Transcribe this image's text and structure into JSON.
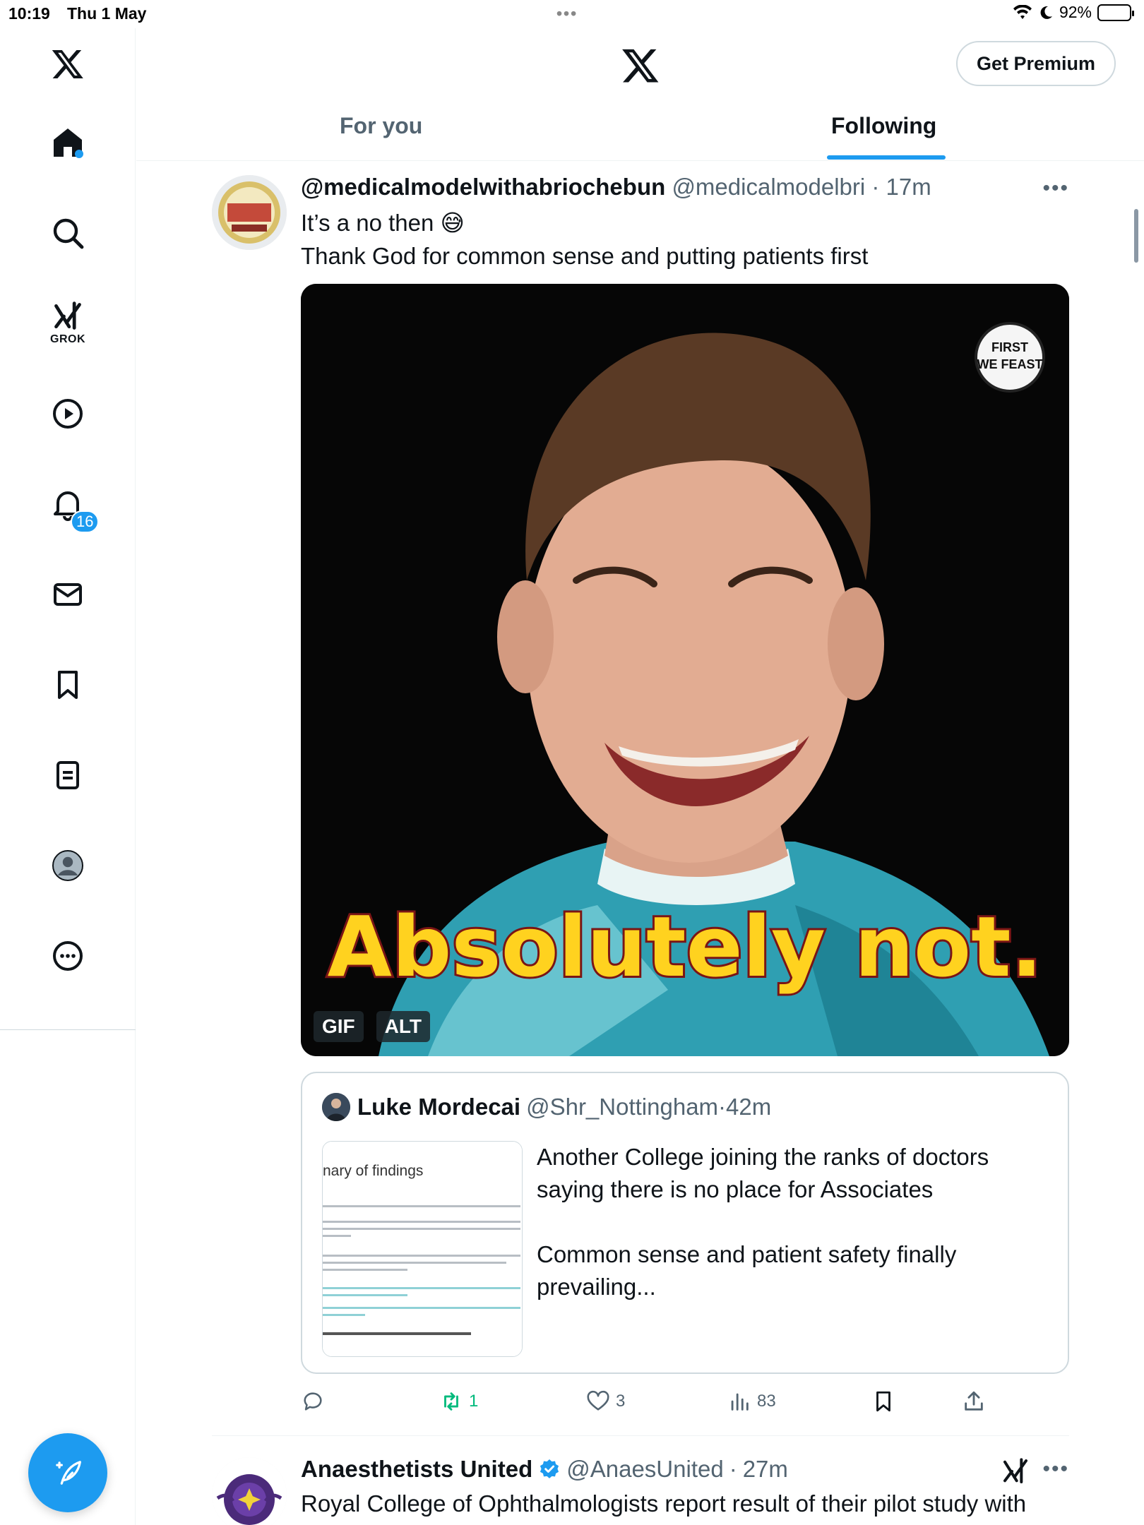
{
  "status_bar": {
    "time": "10:19",
    "date": "Thu 1 May",
    "battery": "92%"
  },
  "header": {
    "premium_label": "Get Premium",
    "tabs": [
      {
        "label": "For you",
        "active": false
      },
      {
        "label": "Following",
        "active": true
      }
    ]
  },
  "sidebar": {
    "items": [
      {
        "name": "x-logo-icon"
      },
      {
        "name": "home-icon"
      },
      {
        "name": "search-icon"
      },
      {
        "name": "grok-icon",
        "label": "GROK"
      },
      {
        "name": "video-icon"
      },
      {
        "name": "notifications-icon",
        "badge": "16"
      },
      {
        "name": "messages-icon"
      },
      {
        "name": "bookmarks-icon"
      },
      {
        "name": "lists-icon"
      },
      {
        "name": "profile-icon"
      },
      {
        "name": "more-icon"
      }
    ],
    "compose_icon": "compose-icon"
  },
  "tweet": {
    "name": "@medicalmodelwithabriochebun",
    "handle": "@medicalmodelbri",
    "time": "17m",
    "line1": "It’s a no then 😅",
    "line2": "Thank God for common sense and putting patients first",
    "media": {
      "caption": "Absolutely not.",
      "badges": [
        "GIF",
        "ALT"
      ]
    },
    "quote": {
      "name": "Luke Mordecai",
      "handle": "@Shr_Nottingham",
      "time": "42m",
      "text": "Another College joining the ranks of doctors saying there is no place for Associates\n\nCommon sense and patient safety finally prevailing...",
      "thumb_heading": "nary of findings"
    },
    "actions": {
      "replies": "",
      "reposts": "1",
      "likes": "3",
      "views": "83"
    }
  },
  "tweet2": {
    "name": "Anaesthetists United",
    "handle": "@AnaesUnited",
    "time": "27m",
    "text": "Royal College of Ophthalmologists report result of their pilot study with"
  },
  "colors": {
    "accent": "#1d9bf0",
    "text": "#0f1419",
    "secondary": "#536471",
    "repost": "#00ba7c",
    "border": "#cfd9de"
  }
}
